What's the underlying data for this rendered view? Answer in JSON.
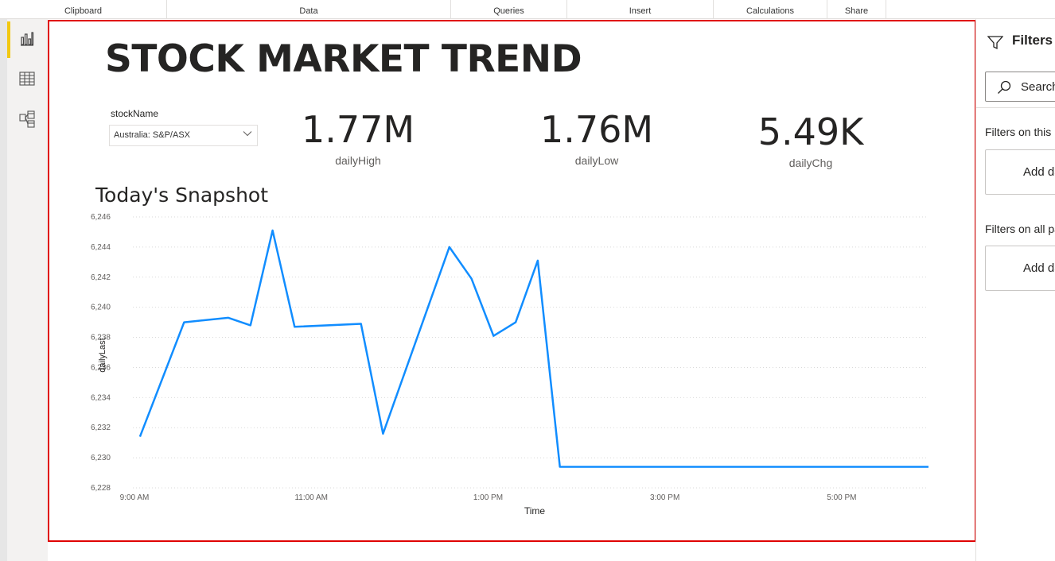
{
  "ribbon": {
    "groups": [
      "Clipboard",
      "Data",
      "Queries",
      "Insert",
      "Calculations",
      "Share"
    ]
  },
  "nav": {
    "icons": [
      "report-view-icon",
      "data-view-icon",
      "model-view-icon"
    ],
    "selected": "report-view-icon",
    "accent": "#f2c811"
  },
  "report": {
    "title": "STOCK MARKET TREND",
    "slicer": {
      "label": "stockName",
      "value": "Australia: S&P/ASX"
    },
    "cards": [
      {
        "value": "1.77M",
        "label": "dailyHigh"
      },
      {
        "value": "1.76M",
        "label": "dailyLow"
      },
      {
        "value": "5.49K",
        "label": "dailyChg"
      }
    ],
    "chart_heading": "Today's Snapshot",
    "selection_border_color": "#e00000"
  },
  "chart_data": {
    "type": "line",
    "xlabel": "Time",
    "ylabel": "dailyLast",
    "ylim": [
      6228,
      6246
    ],
    "xlim": [
      9.0,
      18.0
    ],
    "x_tick_values": [
      9,
      11,
      13,
      15,
      17
    ],
    "x_tick_labels": [
      "9:00 AM",
      "11:00 AM",
      "1:00 PM",
      "3:00 PM",
      "5:00 PM"
    ],
    "y_ticks": [
      6228,
      6230,
      6232,
      6234,
      6236,
      6238,
      6240,
      6242,
      6244,
      6246
    ],
    "y_tick_labels": [
      "6,228",
      "6,230",
      "6,232",
      "6,234",
      "6,236",
      "6,238",
      "6,240",
      "6,242",
      "6,244",
      "6,246"
    ],
    "grid": true,
    "color": "#118dff",
    "series": [
      {
        "x": [
          9.08,
          9.58,
          10.08,
          10.33,
          10.58,
          10.83,
          11.58,
          11.83,
          12.58,
          12.83,
          13.08,
          13.33,
          13.58,
          13.83,
          14.0,
          18.0
        ],
        "values": [
          6231.4,
          6239.0,
          6239.3,
          6238.8,
          6245.1,
          6238.7,
          6238.9,
          6231.6,
          6244.0,
          6241.9,
          6238.1,
          6239.0,
          6243.1,
          6229.4,
          6229.4,
          6229.4
        ]
      }
    ]
  },
  "filters": {
    "title": "Filters",
    "search_placeholder": "Search",
    "section_page": "Filters on this page",
    "section_all": "Filters on all pages",
    "add_label": "Add data fields here"
  }
}
